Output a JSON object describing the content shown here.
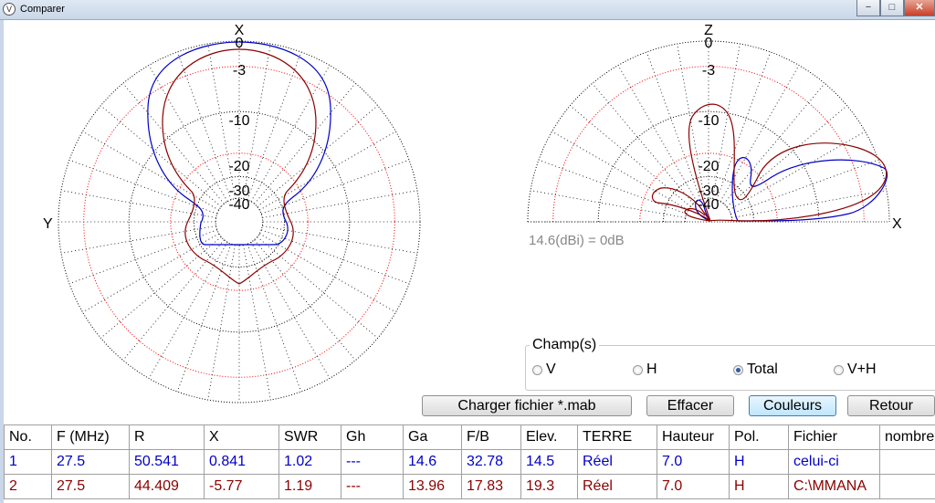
{
  "window": {
    "title": "Comparer",
    "app_icon": "V",
    "minimize": "−",
    "maximize": "□",
    "close": "✕"
  },
  "left_plot": {
    "labels": {
      "top": "X",
      "left": "Y"
    },
    "rings": [
      "0",
      "-3",
      "-10",
      "-20",
      "-30",
      "-40"
    ]
  },
  "right_plot": {
    "labels": {
      "top": "Z",
      "right": "X"
    },
    "rings": [
      "0",
      "-3",
      "-10",
      "-20",
      "-30",
      "-40"
    ]
  },
  "reference_label": "14.6(dBi) = 0dB",
  "champs": {
    "title": "Champ(s)",
    "options": [
      {
        "label": "V",
        "selected": false
      },
      {
        "label": "H",
        "selected": false
      },
      {
        "label": "Total",
        "selected": true
      },
      {
        "label": "V+H",
        "selected": false
      }
    ]
  },
  "buttons": {
    "load": "Charger fichier *.mab",
    "clear": "Effacer",
    "colors": "Couleurs",
    "back": "Retour"
  },
  "table": {
    "headers": [
      "No.",
      "F (MHz)",
      "R",
      "X",
      "SWR",
      "Gh",
      "Ga",
      "F/B",
      "Elev.",
      "TERRE",
      "Hauteur",
      "Pol.",
      "Fichier",
      "nombre"
    ],
    "rows": [
      [
        "1",
        "27.5",
        "50.541",
        "0.841",
        "1.02",
        "---",
        "14.6",
        "32.78",
        "14.5",
        "Réel",
        "7.0",
        "H",
        "celui-ci",
        ""
      ],
      [
        "2",
        "27.5",
        "44.409",
        "-5.77",
        "1.19",
        "---",
        "13.96",
        "17.83",
        "19.3",
        "Réel",
        "7.0",
        "H",
        "C:\\MMANA",
        ""
      ]
    ]
  },
  "colors": {
    "series1": "#0000c8",
    "series2": "#8b0000",
    "grid_dark": "#000000",
    "grid_red": "#ff0000"
  }
}
